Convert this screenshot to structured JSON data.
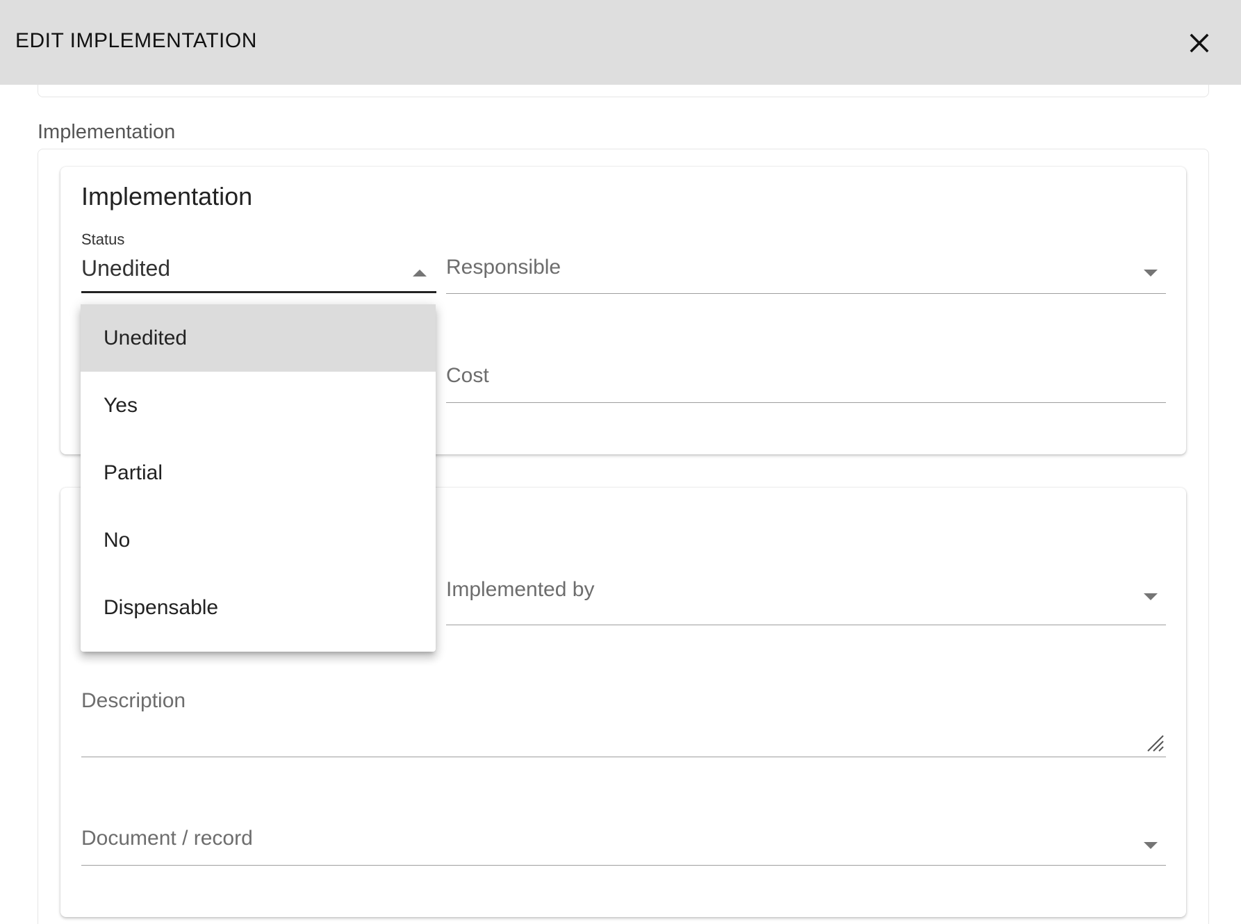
{
  "dialog": {
    "title_first": "E",
    "title_rest": "DIT IMPLEMENTATION",
    "close_icon": "close-icon"
  },
  "section": {
    "label": "Implementation"
  },
  "implementation_card": {
    "title": "Implementation",
    "status": {
      "label": "Status",
      "value": "Unedited"
    },
    "responsible": {
      "label": "Responsible"
    },
    "cost": {
      "label": "Cost"
    }
  },
  "status_dropdown": {
    "options": [
      "Unedited",
      "Yes",
      "Partial",
      "No",
      "Dispensable"
    ],
    "selected": "Unedited"
  },
  "details_card": {
    "implemented_by": {
      "label": "Implemented by"
    },
    "description": {
      "label": "Description"
    },
    "document_record": {
      "label": "Document / record"
    }
  }
}
